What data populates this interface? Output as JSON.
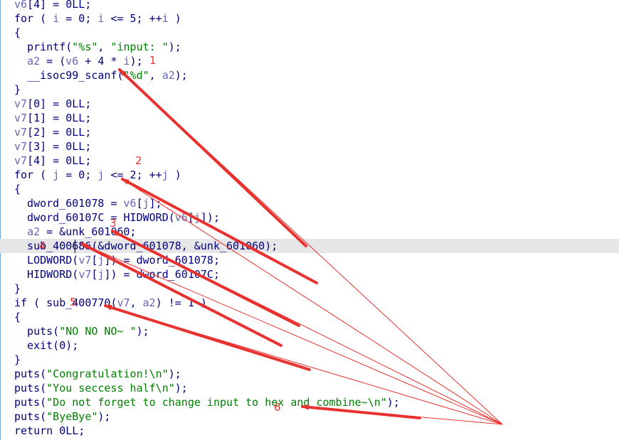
{
  "editor": {
    "highlighted_line_index": 17,
    "lines": [
      [
        {
          "t": "v6",
          "c": "var"
        },
        {
          "t": "[4] = 0LL;",
          "c": "plain"
        }
      ],
      [
        {
          "t": "for ( ",
          "c": "kw"
        },
        {
          "t": "i",
          "c": "var"
        },
        {
          "t": " = 0; ",
          "c": "plain"
        },
        {
          "t": "i",
          "c": "var"
        },
        {
          "t": " <= 5; ++",
          "c": "plain"
        },
        {
          "t": "i",
          "c": "var"
        },
        {
          "t": " )",
          "c": "plain"
        }
      ],
      [
        {
          "t": "{",
          "c": "plain"
        }
      ],
      [
        {
          "t": "  printf(",
          "c": "plain"
        },
        {
          "t": "\"%s\"",
          "c": "str"
        },
        {
          "t": ", ",
          "c": "plain"
        },
        {
          "t": "\"input: \"",
          "c": "str"
        },
        {
          "t": ");",
          "c": "plain"
        }
      ],
      [
        {
          "t": "  ",
          "c": "plain"
        },
        {
          "t": "a2",
          "c": "var"
        },
        {
          "t": " = (",
          "c": "plain"
        },
        {
          "t": "v6",
          "c": "var"
        },
        {
          "t": " + 4 * ",
          "c": "plain"
        },
        {
          "t": "i",
          "c": "var"
        },
        {
          "t": ");",
          "c": "plain"
        }
      ],
      [
        {
          "t": "  __isoc99_scanf(",
          "c": "plain"
        },
        {
          "t": "\"%d\"",
          "c": "str"
        },
        {
          "t": ", ",
          "c": "plain"
        },
        {
          "t": "a2",
          "c": "var"
        },
        {
          "t": ");",
          "c": "plain"
        }
      ],
      [
        {
          "t": "}",
          "c": "plain"
        }
      ],
      [
        {
          "t": "v7",
          "c": "var"
        },
        {
          "t": "[0] = 0LL;",
          "c": "plain"
        }
      ],
      [
        {
          "t": "v7",
          "c": "var"
        },
        {
          "t": "[1] = 0LL;",
          "c": "plain"
        }
      ],
      [
        {
          "t": "v7",
          "c": "var"
        },
        {
          "t": "[2] = 0LL;",
          "c": "plain"
        }
      ],
      [
        {
          "t": "v7",
          "c": "var"
        },
        {
          "t": "[3] = 0LL;",
          "c": "plain"
        }
      ],
      [
        {
          "t": "v7",
          "c": "var"
        },
        {
          "t": "[4] = 0LL;",
          "c": "plain"
        }
      ],
      [
        {
          "t": "for ( ",
          "c": "kw"
        },
        {
          "t": "j",
          "c": "var"
        },
        {
          "t": " = 0; ",
          "c": "plain"
        },
        {
          "t": "j",
          "c": "var"
        },
        {
          "t": " <= 2; ++",
          "c": "plain"
        },
        {
          "t": "j",
          "c": "var"
        },
        {
          "t": " )",
          "c": "plain"
        }
      ],
      [
        {
          "t": "{",
          "c": "plain"
        }
      ],
      [
        {
          "t": "  dword_601078 = ",
          "c": "plain"
        },
        {
          "t": "v6",
          "c": "var"
        },
        {
          "t": "[",
          "c": "plain"
        },
        {
          "t": "j",
          "c": "var"
        },
        {
          "t": "];",
          "c": "plain"
        }
      ],
      [
        {
          "t": "  dword_60107C = HIDWORD(",
          "c": "plain"
        },
        {
          "t": "v6",
          "c": "var"
        },
        {
          "t": "[",
          "c": "plain"
        },
        {
          "t": "j",
          "c": "var"
        },
        {
          "t": "]);",
          "c": "plain"
        }
      ],
      [
        {
          "t": "  ",
          "c": "plain"
        },
        {
          "t": "a2",
          "c": "var"
        },
        {
          "t": " = &unk_601060;",
          "c": "plain"
        }
      ],
      [
        {
          "t": "  sub_400686(&dword_601078, &unk_601060);",
          "c": "plain"
        }
      ],
      [
        {
          "t": "  LODWORD(",
          "c": "plain"
        },
        {
          "t": "v7",
          "c": "var"
        },
        {
          "t": "[",
          "c": "plain"
        },
        {
          "t": "j",
          "c": "var"
        },
        {
          "t": "]) = dword_601078;",
          "c": "plain"
        }
      ],
      [
        {
          "t": "  HIDWORD(",
          "c": "plain"
        },
        {
          "t": "v7",
          "c": "var"
        },
        {
          "t": "[",
          "c": "plain"
        },
        {
          "t": "j",
          "c": "var"
        },
        {
          "t": "]) = dword_60107C;",
          "c": "plain"
        }
      ],
      [
        {
          "t": "}",
          "c": "plain"
        }
      ],
      [
        {
          "t": "if ( ",
          "c": "kw"
        },
        {
          "t": "sub_400770(",
          "c": "plain"
        },
        {
          "t": "v7",
          "c": "var"
        },
        {
          "t": ", ",
          "c": "plain"
        },
        {
          "t": "a2",
          "c": "var"
        },
        {
          "t": ") != 1 )",
          "c": "plain"
        }
      ],
      [
        {
          "t": "{",
          "c": "plain"
        }
      ],
      [
        {
          "t": "  puts(",
          "c": "plain"
        },
        {
          "t": "\"NO NO NO~ \"",
          "c": "str"
        },
        {
          "t": ");",
          "c": "plain"
        }
      ],
      [
        {
          "t": "  exit(0);",
          "c": "plain"
        }
      ],
      [
        {
          "t": "}",
          "c": "plain"
        }
      ],
      [
        {
          "t": "puts(",
          "c": "plain"
        },
        {
          "t": "\"Congratulation!\\n\"",
          "c": "str"
        },
        {
          "t": ");",
          "c": "plain"
        }
      ],
      [
        {
          "t": "puts(",
          "c": "plain"
        },
        {
          "t": "\"You seccess half\\n\"",
          "c": "str"
        },
        {
          "t": ");",
          "c": "plain"
        }
      ],
      [
        {
          "t": "puts(",
          "c": "plain"
        },
        {
          "t": "\"Do not forget to change input to hex and combine~\\n\"",
          "c": "str"
        },
        {
          "t": ");",
          "c": "plain"
        }
      ],
      [
        {
          "t": "puts(",
          "c": "plain"
        },
        {
          "t": "\"ByeBye\"",
          "c": "str"
        },
        {
          "t": ");",
          "c": "plain"
        }
      ],
      [
        {
          "t": "return 0LL;",
          "c": "kw"
        }
      ]
    ]
  },
  "annotations": {
    "color": "#e8322f",
    "labels": [
      "1",
      "2",
      "3",
      "4",
      "5",
      "6"
    ]
  },
  "colors": {
    "plain": "#000080",
    "variable": "#6565b8",
    "string": "#008000",
    "highlight": "#e6e6e6",
    "arrow": "#e8322f"
  }
}
